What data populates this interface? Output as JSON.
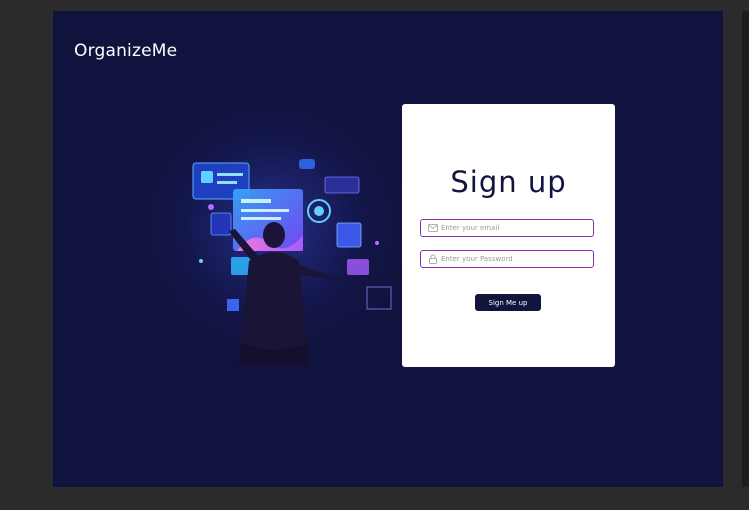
{
  "brand": {
    "name": "OrganizeMe"
  },
  "signup": {
    "title": "Sign up",
    "email_placeholder": "Enter your email",
    "password_placeholder": "Enter your Password",
    "submit_label": "Sign Me up"
  },
  "colors": {
    "page_background": "#11133f",
    "outer_background": "#2b2b2b",
    "card_background": "#ffffff",
    "input_border": "#8f2fb8",
    "button_background": "#12143d"
  },
  "icons": {
    "email": "envelope-icon",
    "password": "lock-icon"
  }
}
